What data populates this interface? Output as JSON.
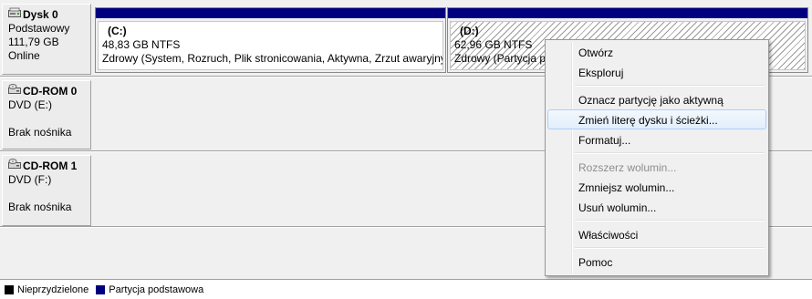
{
  "disks": [
    {
      "name": "Dysk 0",
      "icon": "hard-disk-icon",
      "type": "Podstawowy",
      "size": "111,79 GB",
      "status": "Online",
      "partitions": [
        {
          "label": "(C:)",
          "size_fs": "48,83 GB NTFS",
          "status": "Zdrowy (System, Rozruch, Plik stronicowania, Aktywna, Zrzut awaryjny"
        },
        {
          "label": "(D:)",
          "size_fs": "62,96 GB NTFS",
          "status": "Zdrowy (Partycja p"
        }
      ]
    },
    {
      "name": "CD-ROM 0",
      "icon": "cdrom-icon",
      "type": "DVD (E:)",
      "media": "Brak nośnika"
    },
    {
      "name": "CD-ROM 1",
      "icon": "cdrom-icon",
      "type": "DVD (F:)",
      "media": "Brak nośnika"
    }
  ],
  "legend": [
    {
      "label": "Nieprzydzielone",
      "color": "#000000"
    },
    {
      "label": "Partycja podstawowa",
      "color": "#00007f"
    }
  ],
  "context_menu": {
    "items": [
      {
        "label": "Otwórz",
        "state": "normal"
      },
      {
        "label": "Eksploruj",
        "state": "normal"
      },
      {
        "label": "Oznacz partycję jako aktywną",
        "state": "normal"
      },
      {
        "label": "Zmień literę dysku i ścieżki...",
        "state": "hover"
      },
      {
        "label": "Formatuj...",
        "state": "normal"
      },
      {
        "label": "Rozszerz wolumin...",
        "state": "disabled"
      },
      {
        "label": "Zmniejsz wolumin...",
        "state": "normal"
      },
      {
        "label": "Usuń wolumin...",
        "state": "normal"
      },
      {
        "label": "Właściwości",
        "state": "normal"
      },
      {
        "label": "Pomoc",
        "state": "normal"
      }
    ]
  },
  "colors": {
    "primary_partition": "#00007f",
    "unallocated": "#000000",
    "menu_hover_border": "#aecff7"
  }
}
